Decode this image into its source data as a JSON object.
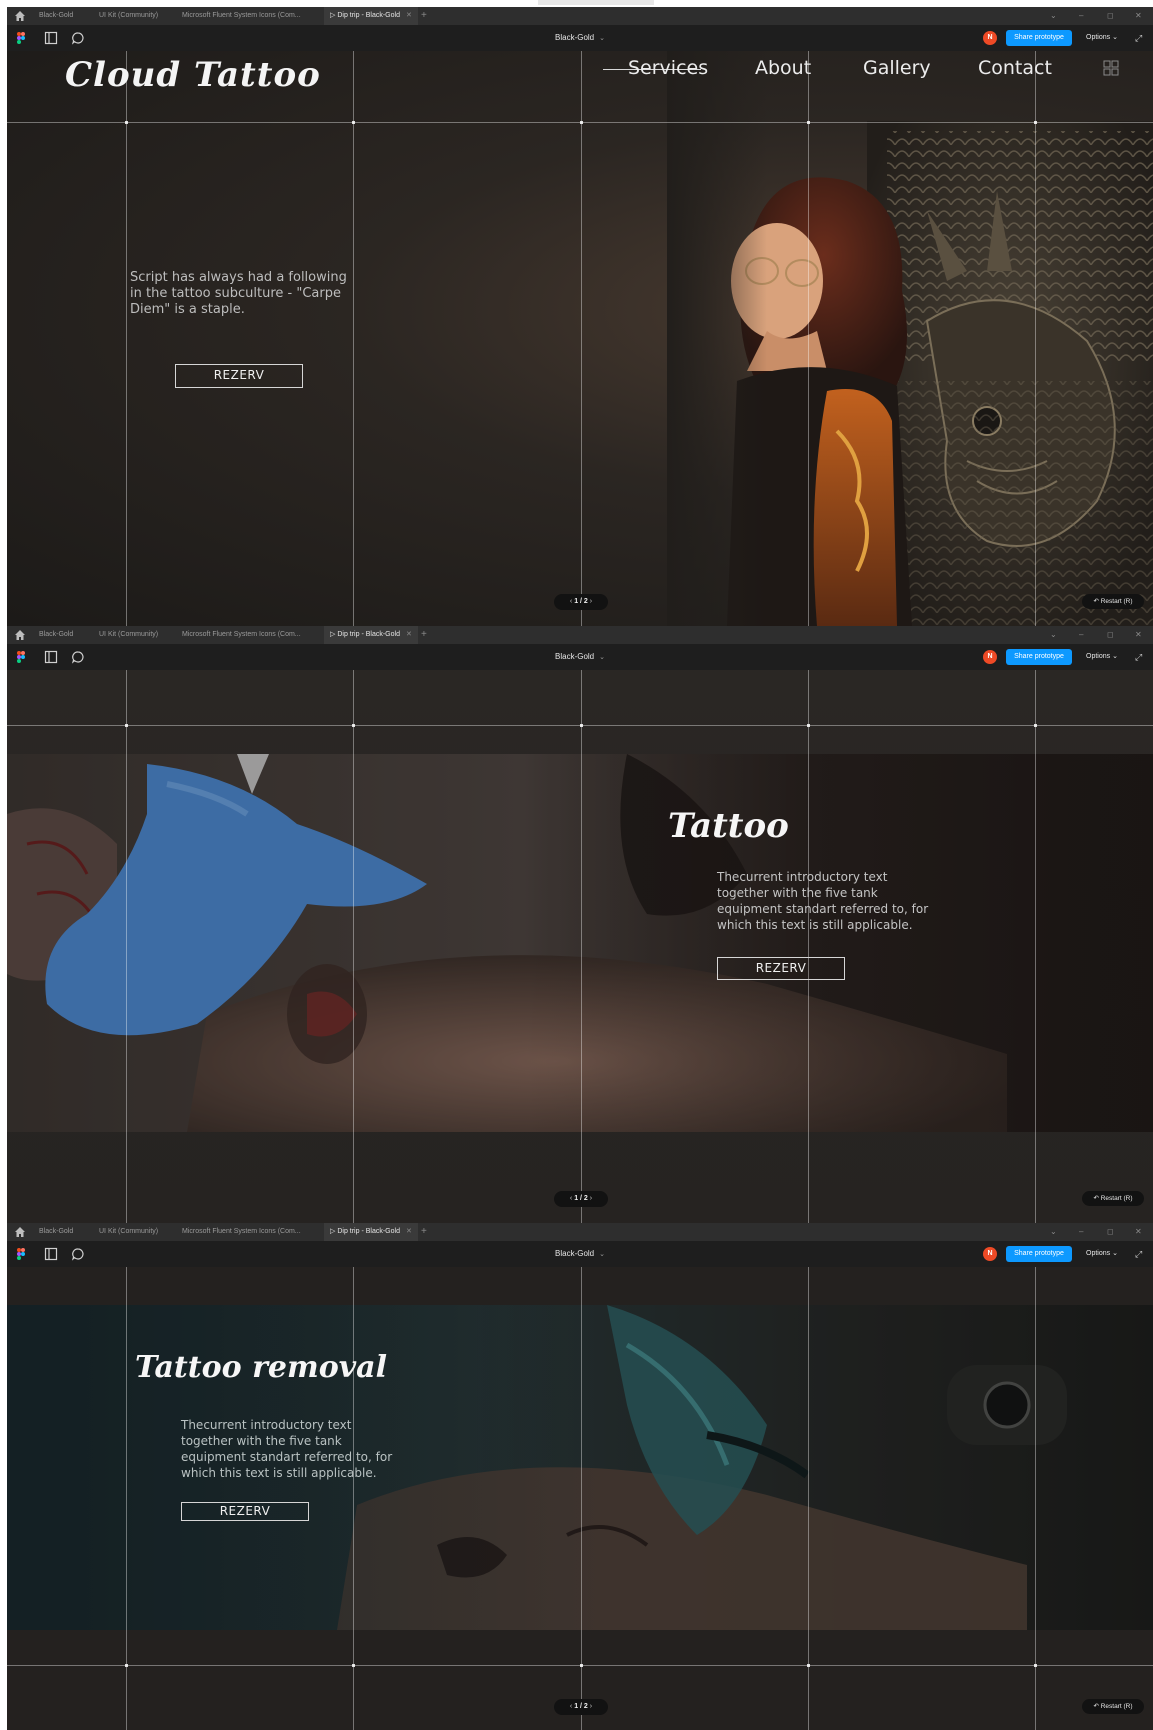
{
  "browser": {
    "tabs": [
      "Black-Gold",
      "UI Kit (Community)",
      "Microsoft Fluent System Icons (Com...",
      "Dip trip - Black-Gold"
    ],
    "active_tab": "Dip trip - Black-Gold",
    "new_tab": "+",
    "window_controls": [
      "⌄",
      "–",
      "◻",
      "✕"
    ]
  },
  "figma": {
    "file_name": "Black-Gold",
    "avatar_initial": "N",
    "share_label": "Share prototype",
    "options_label": "Options",
    "pager": "1 / 2",
    "restart_label": "Restart (R)"
  },
  "site": {
    "brand": "Cloud Tattoo",
    "nav": [
      "Services",
      "About",
      "Gallery",
      "Contact"
    ],
    "hero_text": "Script has always had a following in the tattoo subculture - \"Carpe Diem\" is a staple.",
    "cta": "REZERV"
  },
  "section_tattoo": {
    "title": "Tattoo",
    "text": "Thecurrent introductory text together with the five tank equipment standart referred to, for which this text is still applicable.",
    "cta": "REZERV"
  },
  "section_removal": {
    "title": "Tattoo removal",
    "text": "Thecurrent introductory text together with the five tank equipment standart referred to, for which this text is still applicable.",
    "cta": "REZERV"
  },
  "colors": {
    "share_blue": "#0d99ff",
    "avatar_orange": "#ee4a26",
    "figma_bar": "#1e1e1e",
    "page_bg": "#24211f",
    "accent_text": "#f6f6f6"
  }
}
